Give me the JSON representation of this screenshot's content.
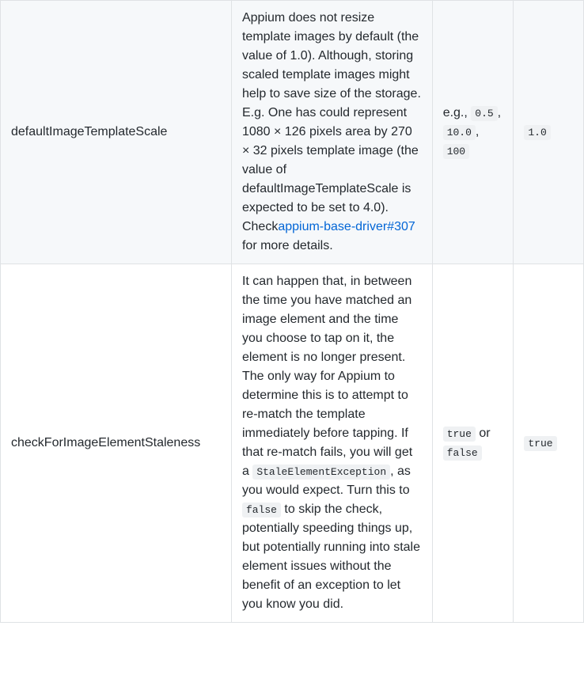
{
  "rows": [
    {
      "name": "defaultImageTemplateScale",
      "desc": {
        "pre": "Appium does not resize template images by default (the value of 1.0). Although, storing scaled template images might help to save size of the storage. E.g. One has could represent 1080 × 126 pixels area by 270 × 32 pixels template image (the value of defaultImageTemplateScale is expected to be set to 4.0). Check",
        "link_text": "appium-base-driver#307",
        "post": " for more details."
      },
      "values": {
        "prefix": "e.g., ",
        "codes": [
          "0.5",
          "10.0",
          "100"
        ]
      },
      "default": "1.0"
    },
    {
      "name": "checkForImageElementStaleness",
      "desc": {
        "pre": "It can happen that, in between the time you have matched an image element and the time you choose to tap on it, the element is no longer present. The only way for Appium to determine this is to attempt to re-match the template immediately before tapping. If that re-match fails, you will get a ",
        "code1": "StaleElementException",
        "mid": ", as you would expect. Turn this to ",
        "code2": "false",
        "post": " to skip the check, potentially speeding things up, but potentially running into stale element issues without the benefit of an exception to let you know you did."
      },
      "values": {
        "codes": [
          "true",
          "false"
        ],
        "joiner": " or "
      },
      "default": "true"
    }
  ]
}
